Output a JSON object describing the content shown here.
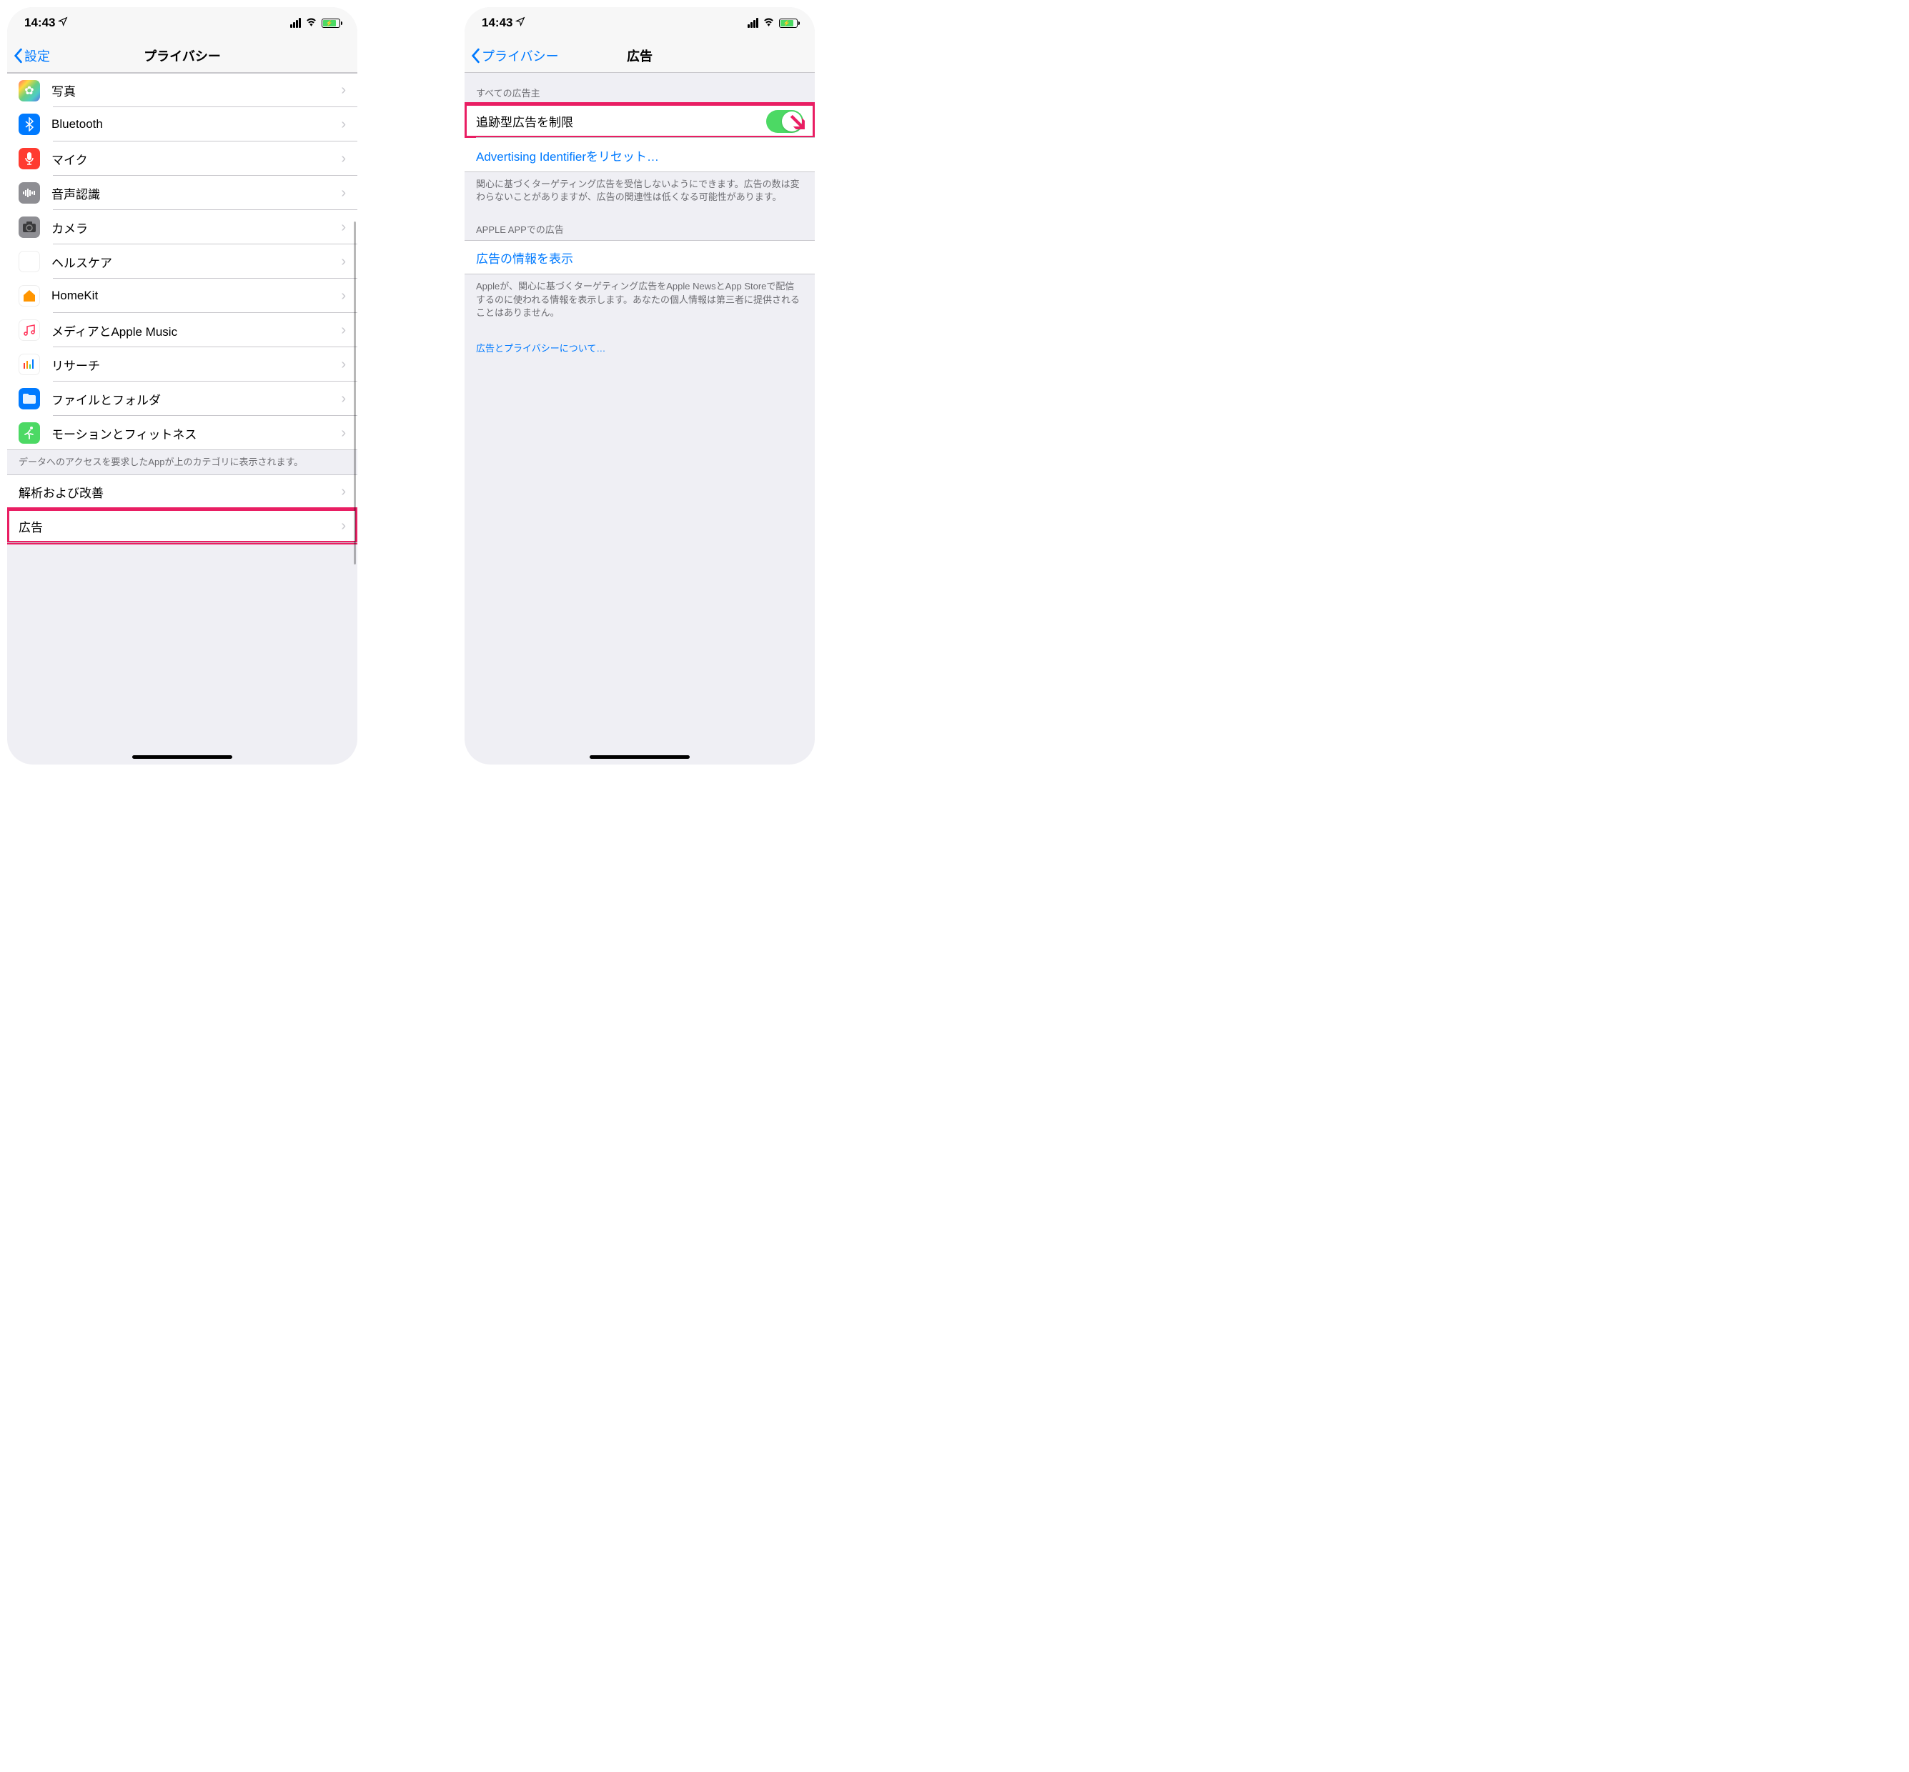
{
  "status": {
    "time": "14:43"
  },
  "left": {
    "back": "設定",
    "title": "プライバシー",
    "items": [
      {
        "label": "写真"
      },
      {
        "label": "Bluetooth"
      },
      {
        "label": "マイク"
      },
      {
        "label": "音声認識"
      },
      {
        "label": "カメラ"
      },
      {
        "label": "ヘルスケア"
      },
      {
        "label": "HomeKit"
      },
      {
        "label": "メディアとApple Music"
      },
      {
        "label": "リサーチ"
      },
      {
        "label": "ファイルとフォルダ"
      },
      {
        "label": "モーションとフィットネス"
      }
    ],
    "footer1": "データへのアクセスを要求したAppが上のカテゴリに表示されます。",
    "items2": [
      {
        "label": "解析および改善"
      },
      {
        "label": "広告"
      }
    ]
  },
  "right": {
    "back": "プライバシー",
    "title": "広告",
    "header1": "すべての広告主",
    "limitTracking": "追跡型広告を制限",
    "resetId": "Advertising Identifierをリセット…",
    "footer1": "関心に基づくターゲティング広告を受信しないようにできます。広告の数は変わらないことがありますが、広告の関連性は低くなる可能性があります。",
    "header2": "APPLE APPでの広告",
    "showAdInfo": "広告の情報を表示",
    "footer2": "Appleが、関心に基づくターゲティング広告をApple NewsとApp Storeで配信するのに使われる情報を表示します。あなたの個人情報は第三者に提供されることはありません。",
    "aboutLink": "広告とプライバシーについて…"
  }
}
